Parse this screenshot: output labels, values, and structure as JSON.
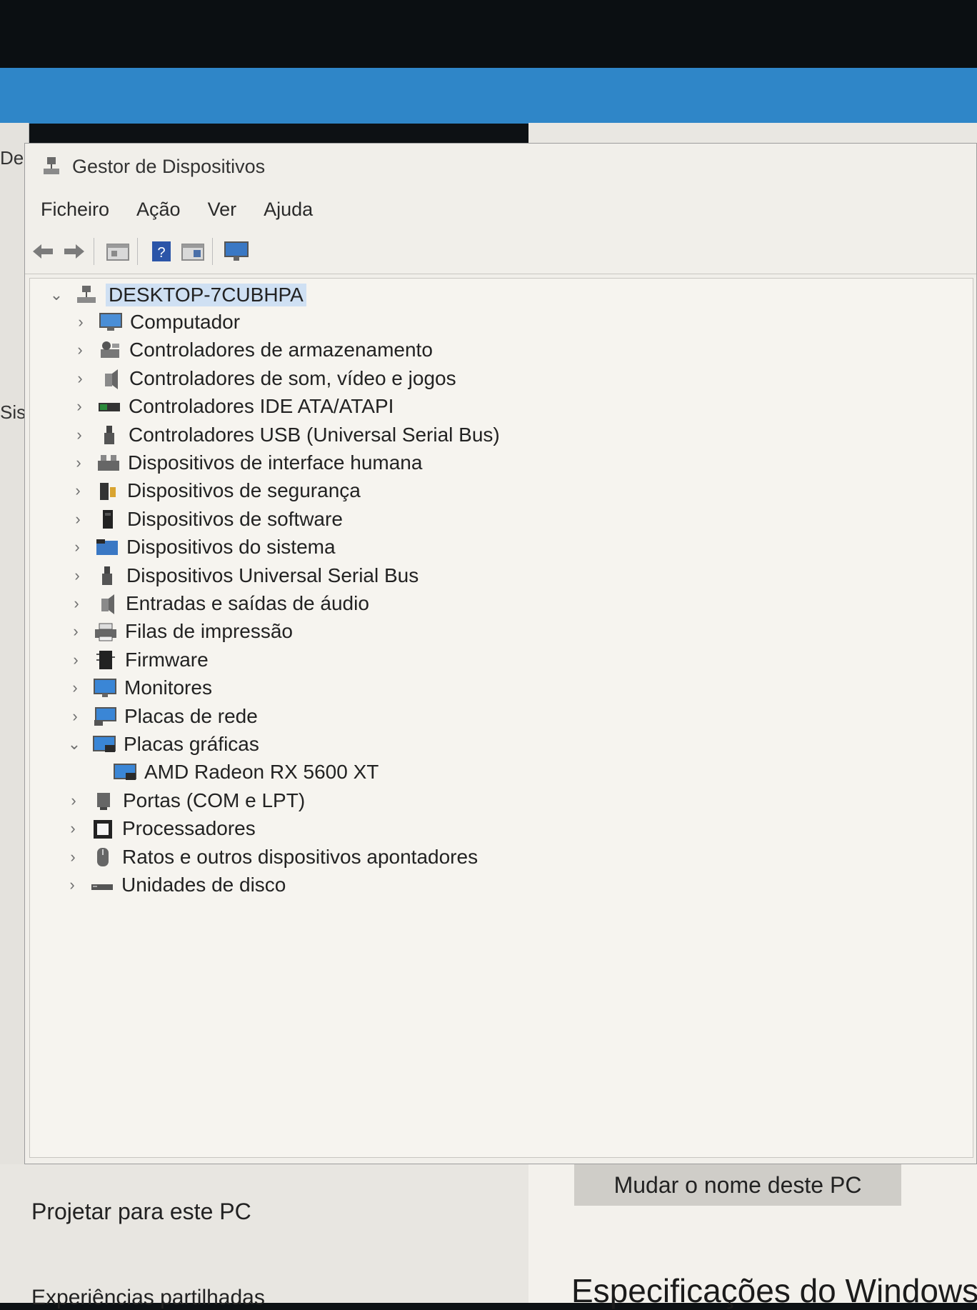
{
  "window": {
    "title": "Gestor de Dispositivos"
  },
  "menu": [
    "Ficheiro",
    "Ação",
    "Ver",
    "Ajuda"
  ],
  "toolbar": {
    "icons": [
      "back-arrow-icon",
      "forward-arrow-icon",
      "properties-icon",
      "help-icon",
      "update-driver-icon",
      "monitor-icon"
    ]
  },
  "tree": {
    "root": "DESKTOP-7CUBHPA",
    "categories": [
      {
        "label": "Computador",
        "icon": "computer-icon"
      },
      {
        "label": "Controladores de armazenamento",
        "icon": "storage-controller-icon"
      },
      {
        "label": "Controladores de som, vídeo e jogos",
        "icon": "speaker-icon"
      },
      {
        "label": "Controladores IDE ATA/ATAPI",
        "icon": "ide-controller-icon"
      },
      {
        "label": "Controladores USB (Universal Serial Bus)",
        "icon": "usb-icon"
      },
      {
        "label": "Dispositivos de interface humana",
        "icon": "hid-icon"
      },
      {
        "label": "Dispositivos de segurança",
        "icon": "security-icon"
      },
      {
        "label": "Dispositivos de software",
        "icon": "software-device-icon"
      },
      {
        "label": "Dispositivos do sistema",
        "icon": "system-folder-icon"
      },
      {
        "label": "Dispositivos Universal Serial Bus",
        "icon": "usb-icon"
      },
      {
        "label": "Entradas e saídas de áudio",
        "icon": "speaker-icon"
      },
      {
        "label": "Filas de impressão",
        "icon": "printer-icon"
      },
      {
        "label": "Firmware",
        "icon": "firmware-icon"
      },
      {
        "label": "Monitores",
        "icon": "monitor-icon"
      },
      {
        "label": "Placas de rede",
        "icon": "network-adapter-icon"
      },
      {
        "label": "Placas gráficas",
        "icon": "display-adapter-icon",
        "expanded": true
      },
      {
        "label": "AMD Radeon RX 5600 XT",
        "icon": "display-adapter-icon",
        "child": true
      },
      {
        "label": "Portas (COM e LPT)",
        "icon": "port-icon"
      },
      {
        "label": "Processadores",
        "icon": "processor-icon"
      },
      {
        "label": "Ratos e outros dispositivos apontadores",
        "icon": "mouse-icon"
      },
      {
        "label": "Unidades de disco",
        "icon": "disk-drive-icon"
      }
    ]
  },
  "background": {
    "left_fragments": [
      "De",
      "Sis"
    ],
    "rename_button": "Mudar o nome deste PC",
    "projetar": "Projetar para este PC",
    "experiencias": "Experiências partilhadas",
    "specs": "Especificações do Windows"
  }
}
